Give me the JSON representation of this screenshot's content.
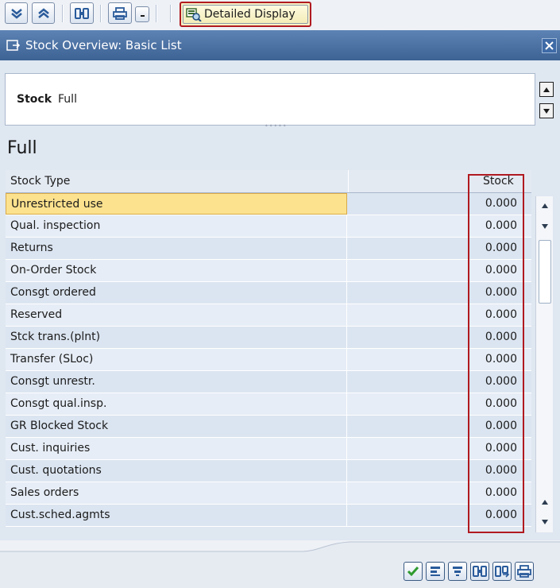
{
  "toolbar": {
    "detail_label": "Detailed Display",
    "icons": [
      "scroll-down-icon",
      "scroll-up-icon",
      "find-icon",
      "print-icon",
      "dropdown-icon",
      "detail-display-icon"
    ]
  },
  "window": {
    "title": "Stock Overview: Basic List"
  },
  "header": {
    "stock_label": "Stock",
    "stock_value": "Full"
  },
  "section": {
    "title": "Full"
  },
  "table": {
    "columns": [
      "Stock Type",
      "Stock"
    ],
    "rows": [
      {
        "type": "Unrestricted use",
        "stock": "0.000"
      },
      {
        "type": "Qual. inspection",
        "stock": "0.000"
      },
      {
        "type": "Returns",
        "stock": "0.000"
      },
      {
        "type": "On-Order Stock",
        "stock": "0.000"
      },
      {
        "type": "Consgt ordered",
        "stock": "0.000"
      },
      {
        "type": "Reserved",
        "stock": "0.000"
      },
      {
        "type": "Stck trans.(plnt)",
        "stock": "0.000"
      },
      {
        "type": "Transfer (SLoc)",
        "stock": "0.000"
      },
      {
        "type": "Consgt unrestr.",
        "stock": "0.000"
      },
      {
        "type": "Consgt qual.insp.",
        "stock": "0.000"
      },
      {
        "type": "GR Blocked Stock",
        "stock": "0.000"
      },
      {
        "type": "Cust. inquiries",
        "stock": "0.000"
      },
      {
        "type": "Cust. quotations",
        "stock": "0.000"
      },
      {
        "type": "Sales orders",
        "stock": "0.000"
      },
      {
        "type": "Cust.sched.agmts",
        "stock": "0.000"
      }
    ]
  },
  "colors": {
    "accent": "#3d6294",
    "highlight": "#b01a20",
    "selected": "#fce28e"
  },
  "footer": {
    "icons": [
      "check-icon",
      "align-icon",
      "filter-icon",
      "find-icon",
      "find-next-icon",
      "print-icon"
    ]
  }
}
